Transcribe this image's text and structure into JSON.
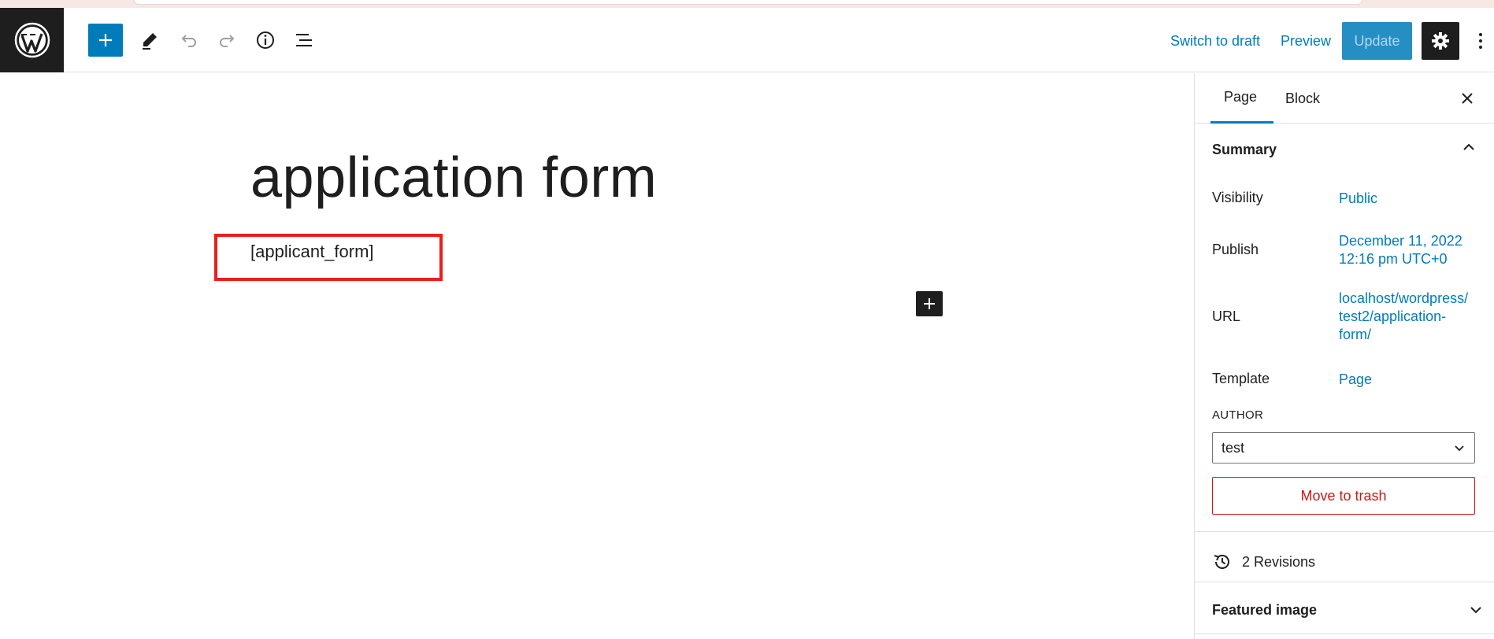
{
  "toolbar": {
    "switch_draft_label": "Switch to draft",
    "preview_label": "Preview",
    "update_label": "Update"
  },
  "editor": {
    "title": "application form",
    "shortcode": "[applicant_form]"
  },
  "sidebar": {
    "tabs": [
      {
        "label": "Page",
        "active": true
      },
      {
        "label": "Block",
        "active": false
      }
    ],
    "summary": {
      "heading": "Summary",
      "rows": {
        "visibility": {
          "label": "Visibility",
          "value": "Public"
        },
        "publish": {
          "label": "Publish",
          "value_line1": "December 11, 2022",
          "value_line2": "12:16 pm UTC+0"
        },
        "url": {
          "label": "URL",
          "value_line1": "localhost/wordpress/",
          "value_line2": "test2/application-",
          "value_line3": "form/"
        },
        "template": {
          "label": "Template",
          "value": "Page"
        }
      },
      "author_label": "AUTHOR",
      "author_value": "test",
      "trash_label": "Move to trash"
    },
    "revisions_label": "2 Revisions",
    "featured_image_label": "Featured image"
  },
  "colors": {
    "accent": "#007cba",
    "dark": "#1e1e1e",
    "danger": "#cc1818",
    "highlight_box": "#ee1c1c"
  },
  "icons": [
    "wordpress-logo-icon",
    "plus-icon",
    "pencil-icon",
    "undo-icon",
    "redo-icon",
    "info-icon",
    "list-view-icon",
    "gear-icon",
    "more-vertical-icon",
    "close-icon",
    "chevron-up-icon",
    "chevron-down-icon",
    "history-icon"
  ]
}
